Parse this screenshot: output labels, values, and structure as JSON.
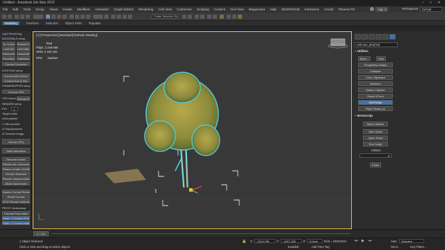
{
  "window": {
    "title": "Untitled - Autodesk 3ds Max 2022"
  },
  "menu": {
    "items": [
      "File",
      "Edit",
      "Tools",
      "Group",
      "Views",
      "Create",
      "Modifiers",
      "Animation",
      "Graph Editors",
      "Rendering",
      "Civil View",
      "Customize",
      "Scripting",
      "Content",
      "Civil View",
      "Megascans",
      "Help",
      "3DGROUND",
      "Interactive",
      "Arnold",
      "Phoenix FD"
    ],
    "signin": "Sign In",
    "workspaces": "Workspaces:",
    "workspace_value": "Default"
  },
  "toolbar": {
    "selection_set": "Create Selection Set"
  },
  "ribbon": {
    "tabs": [
      "Modeling",
      "Freeform",
      "Selection",
      "Object Paint",
      "Populate"
    ]
  },
  "left_panel": {
    "title": "Light Rendering",
    "materials_setup": "MATERIALS setup",
    "mat_buttons": [
      "To Corona",
      "Browse Mat",
      "Unlit Mtl",
      "Unit Diffuse",
      "ReplaceMtl",
      "UnwrapMtl",
      "ShowMaps",
      "HideMaps"
    ],
    "corona_converter": "Corona Converter",
    "lighting_setup": "LIGHTING setup",
    "light_buttons": [
      "Corona light Solver",
      "Corona Sun & Sky"
    ],
    "framebuffer_setup": "FRAMEBUFFER setup",
    "corona_vfb": "Corona VFB",
    "vfb_gamma": "VFB Gamma",
    "render_buffer": "Render Buf",
    "render_setup": "RENDER setup",
    "fire_label": "Fire",
    "fire_value": "1",
    "target_noise": "Target noise",
    "limit_passes": "Limit passes",
    "checks": [
      "Mtl override",
      "Displacement",
      "Denoise image"
    ],
    "render_btn": "Render (F9)",
    "start_interactive": "Start Interactive",
    "bottom_buttons": [
      "Resume render",
      "Render sel. elements",
      "Region render On/Off",
      "Render Selected",
      "Render Selected Mask",
      "Attach last render",
      "Assign Corona Render",
      "Reset Corona",
      "(F10) Render settings"
    ],
    "proxy_title": "PROXY tools/setup",
    "proxy_buttons": [
      "Corona Proxy label",
      "Wrap -> Corona Proxy",
      "Wrap -> Corona scatter"
    ]
  },
  "viewport": {
    "label": "[+] [Perspective] [Standard] [Default Shading]",
    "stats_total": "Total",
    "stats_polys_label": "Polys:",
    "stats_polys": "2 248 095",
    "stats_verts_label": "Verts:",
    "stats_verts": "2 444 181",
    "stats_fps_label": "FPS:",
    "stats_fps": "Inactive"
  },
  "right_panel": {
    "object_name": "Ash tree_001[?m]",
    "utilities_head": "Utilities",
    "more_btn": "More...",
    "sets_btn": "Sets",
    "utility_buttons": [
      "Perspective Match",
      "Collapse",
      "Color Clipboard",
      "Measure",
      "Motion Capture",
      "Reset XForm",
      "MAXScript",
      "Flight Studio (c)"
    ],
    "maxscript_head": "MAXScript",
    "maxscript_buttons": [
      "Open Listener",
      "New Script",
      "Open Script",
      "Run Script"
    ],
    "utilities_sub": "Utilities",
    "close_btn": "Close"
  },
  "timeline": {
    "position": "0 / 100"
  },
  "status": {
    "selection": "1 Object Selected",
    "prompt": "Click or click-and-drag to select objects",
    "x_label": "X:",
    "x": "-2214,266",
    "y_label": "Y:",
    "y": "-1007,328",
    "z_label": "Z:",
    "z": "0,0mm",
    "grid": "Grid = 1000,0mm",
    "enabled": "Enabled:",
    "add_time_tag": "Add Time Tag",
    "autokey": "Auto",
    "selected": "Selected",
    "setkey": "Set K.",
    "key_filters": "Key Filters..."
  }
}
